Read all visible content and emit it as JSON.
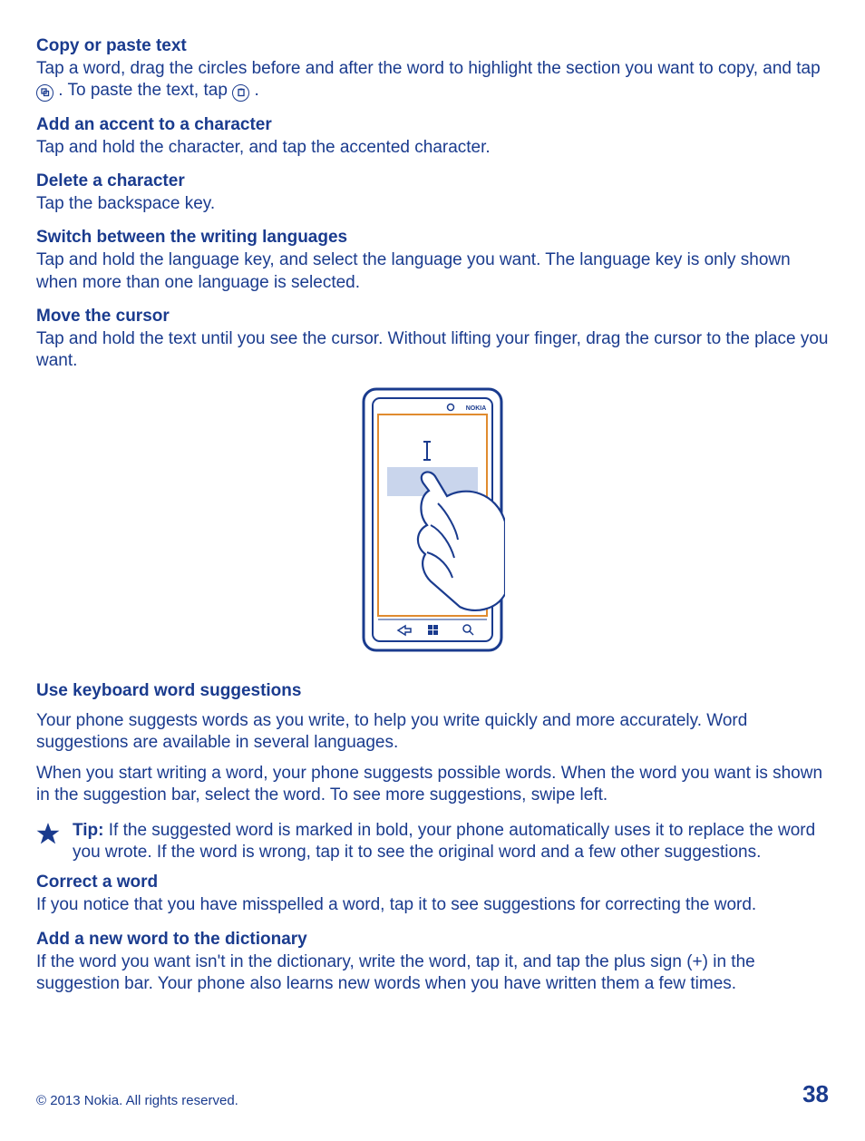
{
  "sections": {
    "copy_paste": {
      "heading": "Copy or paste text",
      "p1a": "Tap a word, drag the circles before and after the word to highlight the section you want to copy, and tap ",
      "p1b": ". To paste the text, tap ",
      "p1c": "."
    },
    "accent": {
      "heading": "Add an accent to a character",
      "p": "Tap and hold the character, and tap the accented character."
    },
    "delete": {
      "heading": "Delete a character",
      "p": "Tap the backspace key."
    },
    "switch_lang": {
      "heading": "Switch between the writing languages",
      "p": "Tap and hold the language key, and select the language you want. The language key is only shown when more than one language is selected."
    },
    "move_cursor": {
      "heading": "Move the cursor",
      "p": "Tap and hold the text until you see the cursor. Without lifting your finger, drag the cursor to the place you want."
    },
    "suggestions": {
      "heading": "Use keyboard word suggestions",
      "p1": "Your phone suggests words as you write, to help you write quickly and more accurately. Word suggestions are available in several languages.",
      "p2": "When you start writing a word, your phone suggests possible words. When the word you want is shown in the suggestion bar, select the word. To see more suggestions, swipe left.",
      "tip_label": "Tip: ",
      "tip_body": "If the suggested word is marked in bold, your phone automatically uses it to replace the word you wrote. If the word is wrong, tap it to see the original word and a few other suggestions."
    },
    "correct": {
      "heading": "Correct a word",
      "p": "If you notice that you have misspelled a word, tap it to see suggestions for correcting the word."
    },
    "add_word": {
      "heading": "Add a new word to the dictionary",
      "p": "If the word you want isn't in the dictionary, write the word, tap it, and tap the plus sign (+) in the suggestion bar. Your phone also learns new words when you have written them a few times."
    }
  },
  "phone": {
    "brand": "NOKIA"
  },
  "footer": {
    "copyright": "© 2013 Nokia. All rights reserved.",
    "page": "38"
  }
}
